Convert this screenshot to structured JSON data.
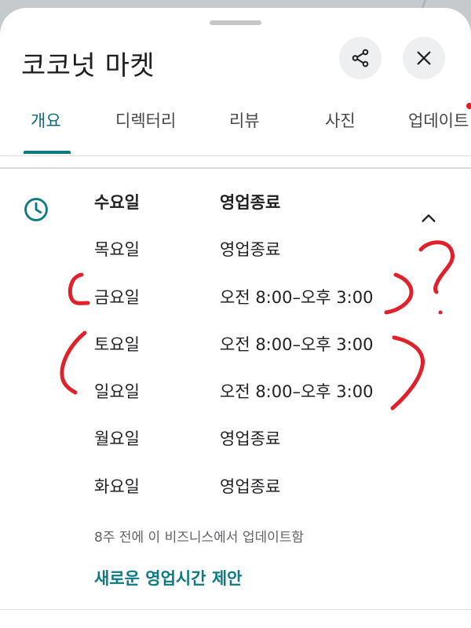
{
  "place": {
    "title": "코코넛 마켓"
  },
  "header": {
    "share_icon": "share-icon",
    "close_icon": "close-icon"
  },
  "tabs": [
    {
      "label": "개요",
      "active": true
    },
    {
      "label": "디렉터리",
      "active": false
    },
    {
      "label": "리뷰",
      "active": false
    },
    {
      "label": "사진",
      "active": false
    },
    {
      "label": "업데이트",
      "active": false
    }
  ],
  "hours": {
    "icon": "clock-icon",
    "rows": [
      {
        "day": "수요일",
        "time": "영업종료",
        "today": true
      },
      {
        "day": "목요일",
        "time": "영업종료"
      },
      {
        "day": "금요일",
        "time": "오전 8:00–오후 3:00"
      },
      {
        "day": "토요일",
        "time": "오전 8:00–오후 3:00"
      },
      {
        "day": "일요일",
        "time": "오전 8:00–오후 3:00"
      },
      {
        "day": "월요일",
        "time": "영업종료"
      },
      {
        "day": "화요일",
        "time": "영업종료"
      }
    ],
    "update_note": "8주 전에 이 비즈니스에서 업데이트함",
    "suggest_link": "새로운 영업시간 제안"
  },
  "colors": {
    "accent": "#0b7a83",
    "annotation": "#e0212c"
  }
}
